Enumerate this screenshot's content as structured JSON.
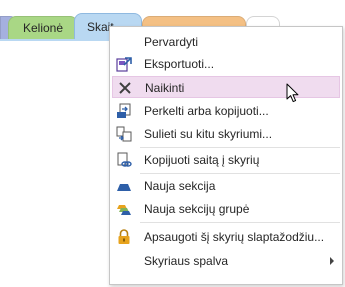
{
  "tabs": [
    {
      "label": "Kelionė",
      "color": "#a9d785"
    },
    {
      "label": "Skait",
      "color": "#b9d8f2",
      "active": true
    },
    {
      "label": "",
      "color": "#f4c084"
    },
    {
      "label": "",
      "color": "#ffffff"
    }
  ],
  "menu": {
    "items": [
      {
        "label": "Pervardyti",
        "icon": "none"
      },
      {
        "label": "Eksportuoti...",
        "icon": "export-icon"
      },
      {
        "label": "Naikinti",
        "icon": "delete-x-icon",
        "highlighted": true
      },
      {
        "label": "Perkelti arba kopijuoti...",
        "icon": "move-copy-icon"
      },
      {
        "label": "Sulieti su kitu skyriumi...",
        "icon": "merge-icon"
      },
      {
        "label": "Kopijuoti saitą į skyrių",
        "icon": "copy-link-icon"
      },
      {
        "label": "Nauja sekcija",
        "icon": "new-section-icon"
      },
      {
        "label": "Nauja sekcijų grupė",
        "icon": "new-section-group-icon"
      },
      {
        "label": "Apsaugoti šį skyrių slaptažodžiu...",
        "icon": "lock-icon"
      },
      {
        "label": "Skyriaus spalva",
        "icon": "none",
        "has_submenu": true
      }
    ]
  },
  "colors": {
    "highlight": "#f0dcef",
    "accent_blue": "#2e5fa8",
    "lock_gold": "#e7a31d"
  }
}
